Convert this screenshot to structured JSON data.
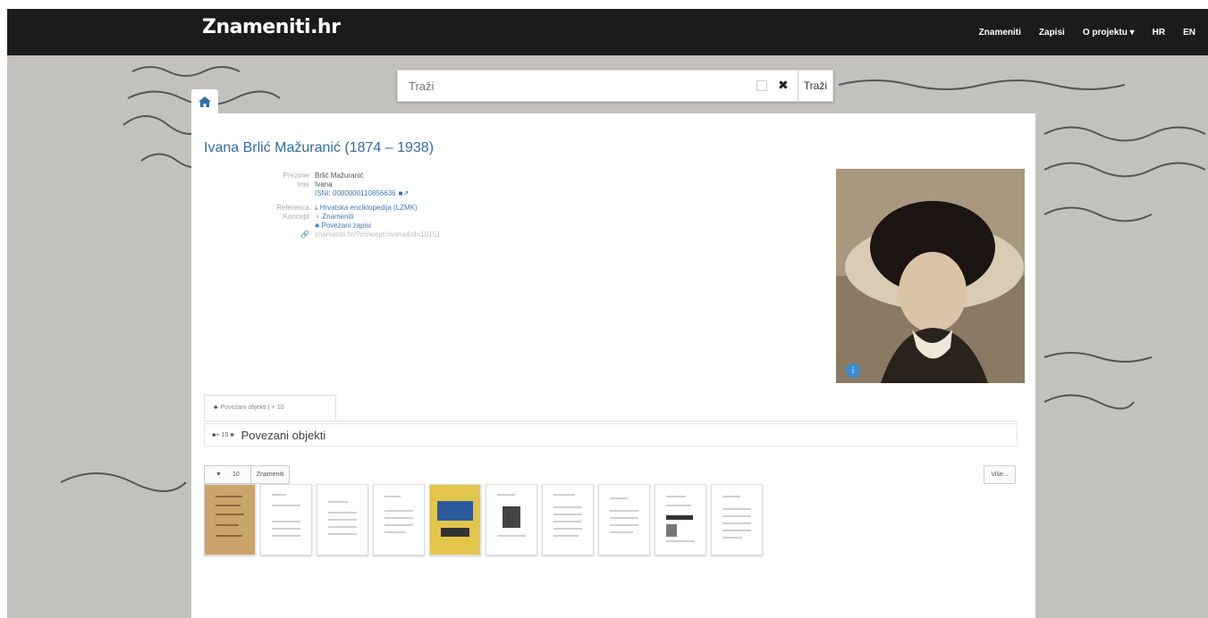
{
  "brand": "Znameniti.hr",
  "nav": {
    "items": [
      "Znameniti",
      "Zapisi",
      "O projektu",
      "HR",
      "EN"
    ]
  },
  "search": {
    "placeholder": "Traži",
    "button_label": "Traži",
    "clear_icon": "✖"
  },
  "person": {
    "title": "Ivana Brlić Mažuranić (1874 – 1938)",
    "fields": [
      {
        "label": "Prezime",
        "value": "Brlić Mažuranić"
      },
      {
        "label": "Ime",
        "value": "Ivana"
      },
      {
        "label": "",
        "value": "ISNI: 0000000110856636"
      },
      {
        "label": "Referenca",
        "value": "Hrvatska enciklopedija (LZMK)"
      },
      {
        "label": "Koncept",
        "value": "Znameniti"
      },
      {
        "label": "",
        "value": "Povezani zapisi"
      },
      {
        "label": "",
        "value": "znameniti.hr/?concept=ivana&id=10151"
      }
    ]
  },
  "tabs": {
    "related_objects": "Povezani objekti ( + 10"
  },
  "section": {
    "mini": "+ 10 ■",
    "title": "Povezani objekti"
  },
  "filters": {
    "count": "10",
    "label": "Znameniti",
    "more": "Više..."
  },
  "thumbnails": [
    {
      "kind": "manuscript"
    },
    {
      "kind": "text"
    },
    {
      "kind": "text"
    },
    {
      "kind": "text"
    },
    {
      "kind": "cover"
    },
    {
      "kind": "photo"
    },
    {
      "kind": "text"
    },
    {
      "kind": "text"
    },
    {
      "kind": "text-image"
    },
    {
      "kind": "text"
    }
  ],
  "colors": {
    "navbar": "#1b1b1b",
    "link": "#2f6ea6",
    "panel": "#ffffff"
  }
}
